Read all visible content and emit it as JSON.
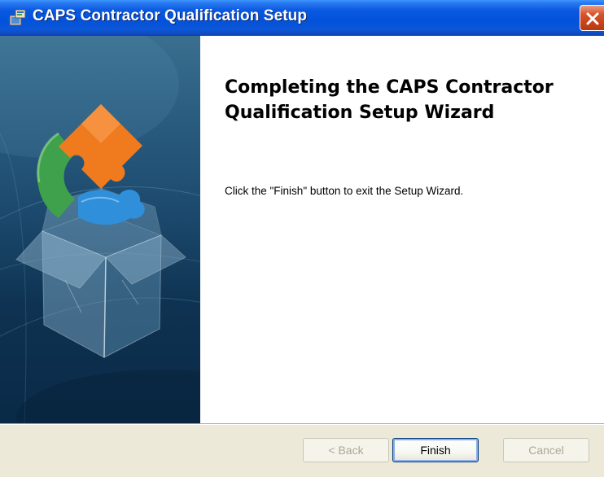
{
  "window": {
    "title": "CAPS Contractor Qualification Setup",
    "icons": {
      "app": "installer-icon",
      "close": "close-icon",
      "banner": "puzzle-box-illustration"
    }
  },
  "content": {
    "heading": "Completing the CAPS Contractor Qualification Setup Wizard",
    "body": "Click the \"Finish\" button to exit the Setup Wizard."
  },
  "buttons": {
    "back": "< Back",
    "finish": "Finish",
    "cancel": "Cancel"
  },
  "colors": {
    "title_bar": "#0352DC",
    "close_button": "#D7532B",
    "dialog_background": "#ECE9D8",
    "banner": "#1C4A6E",
    "puzzle_orange": "#F07A1E",
    "puzzle_green": "#3FA14B",
    "puzzle_blue": "#2F8FDB"
  }
}
